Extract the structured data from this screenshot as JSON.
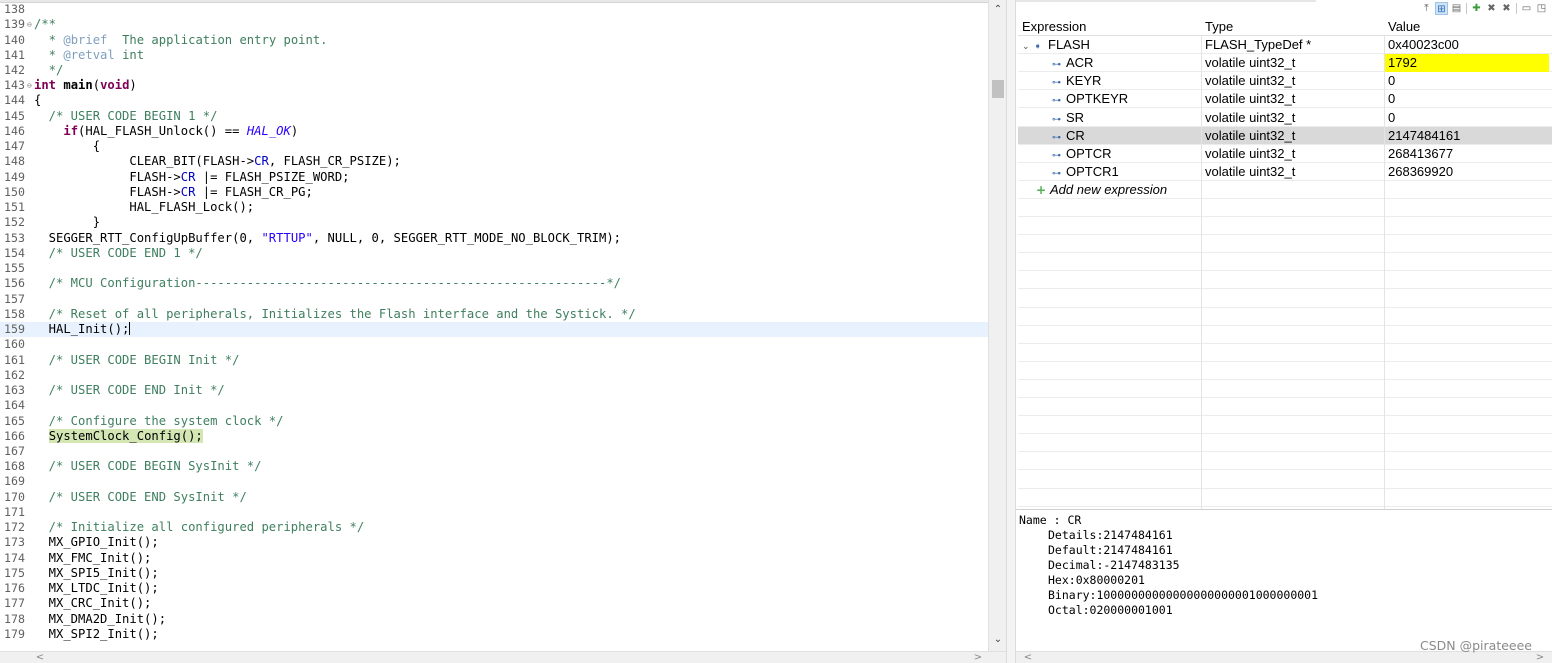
{
  "editor": {
    "lines": [
      {
        "n": "138",
        "fold": "",
        "parts": []
      },
      {
        "n": "139",
        "fold": "⊖",
        "parts": [
          {
            "c": "t-comment",
            "t": "/**"
          }
        ]
      },
      {
        "n": "140",
        "fold": "",
        "parts": [
          {
            "c": "t-comment",
            "t": "  * "
          },
          {
            "c": "t-doctag",
            "t": "@brief"
          },
          {
            "c": "t-comment",
            "t": "  The application entry point."
          }
        ]
      },
      {
        "n": "141",
        "fold": "",
        "parts": [
          {
            "c": "t-comment",
            "t": "  * "
          },
          {
            "c": "t-doctag",
            "t": "@retval"
          },
          {
            "c": "t-comment",
            "t": " int"
          }
        ]
      },
      {
        "n": "142",
        "fold": "",
        "parts": [
          {
            "c": "t-comment",
            "t": "  */"
          }
        ]
      },
      {
        "n": "143",
        "fold": "⊖",
        "parts": [
          {
            "c": "t-keyword",
            "t": "int"
          },
          {
            "c": "",
            "t": " "
          },
          {
            "c": "t-func",
            "t": "main"
          },
          {
            "c": "",
            "t": "("
          },
          {
            "c": "t-keyword",
            "t": "void"
          },
          {
            "c": "",
            "t": ")"
          }
        ]
      },
      {
        "n": "144",
        "fold": "",
        "parts": [
          {
            "c": "",
            "t": "{"
          }
        ]
      },
      {
        "n": "145",
        "fold": "",
        "parts": [
          {
            "c": "t-comment",
            "t": "  /* USER CODE BEGIN 1 */"
          }
        ]
      },
      {
        "n": "146",
        "fold": "",
        "parts": [
          {
            "c": "",
            "t": "    "
          },
          {
            "c": "t-keyword",
            "t": "if"
          },
          {
            "c": "",
            "t": "(HAL_FLASH_Unlock() == "
          },
          {
            "c": "t-macro",
            "t": "HAL_OK"
          },
          {
            "c": "",
            "t": ")"
          }
        ]
      },
      {
        "n": "147",
        "fold": "",
        "parts": [
          {
            "c": "",
            "t": "        {"
          }
        ]
      },
      {
        "n": "148",
        "fold": "",
        "parts": [
          {
            "c": "",
            "t": "             CLEAR_BIT(FLASH->"
          },
          {
            "c": "t-field",
            "t": "CR"
          },
          {
            "c": "",
            "t": ", FLASH_CR_PSIZE);"
          }
        ]
      },
      {
        "n": "149",
        "fold": "",
        "parts": [
          {
            "c": "",
            "t": "             FLASH->"
          },
          {
            "c": "t-field",
            "t": "CR"
          },
          {
            "c": "",
            "t": " |= FLASH_PSIZE_WORD;"
          }
        ]
      },
      {
        "n": "150",
        "fold": "",
        "parts": [
          {
            "c": "",
            "t": "             FLASH->"
          },
          {
            "c": "t-field",
            "t": "CR"
          },
          {
            "c": "",
            "t": " |= FLASH_CR_PG;"
          }
        ]
      },
      {
        "n": "151",
        "fold": "",
        "parts": [
          {
            "c": "",
            "t": "             HAL_FLASH_Lock();"
          }
        ]
      },
      {
        "n": "152",
        "fold": "",
        "parts": [
          {
            "c": "",
            "t": "        }"
          }
        ]
      },
      {
        "n": "153",
        "fold": "",
        "parts": [
          {
            "c": "",
            "t": "  SEGGER_RTT_ConfigUpBuffer(0, "
          },
          {
            "c": "t-string",
            "t": "\"RTTUP\""
          },
          {
            "c": "",
            "t": ", NULL, 0, SEGGER_RTT_MODE_NO_BLOCK_TRIM);"
          }
        ]
      },
      {
        "n": "154",
        "fold": "",
        "parts": [
          {
            "c": "t-comment",
            "t": "  /* USER CODE END 1 */"
          }
        ]
      },
      {
        "n": "155",
        "fold": "",
        "parts": []
      },
      {
        "n": "156",
        "fold": "",
        "parts": [
          {
            "c": "t-comment",
            "t": "  /* MCU Configuration--------------------------------------------------------*/"
          }
        ]
      },
      {
        "n": "157",
        "fold": "",
        "parts": []
      },
      {
        "n": "158",
        "fold": "",
        "parts": [
          {
            "c": "t-comment",
            "t": "  /* Reset of all peripherals, Initializes the Flash interface and the Systick. */"
          }
        ]
      },
      {
        "n": "159",
        "fold": "",
        "current": true,
        "caret": true,
        "parts": [
          {
            "c": "",
            "t": "  HAL_Init();"
          }
        ]
      },
      {
        "n": "160",
        "fold": "",
        "parts": []
      },
      {
        "n": "161",
        "fold": "",
        "parts": [
          {
            "c": "t-comment",
            "t": "  /* USER CODE BEGIN Init */"
          }
        ]
      },
      {
        "n": "162",
        "fold": "",
        "parts": []
      },
      {
        "n": "163",
        "fold": "",
        "parts": [
          {
            "c": "t-comment",
            "t": "  /* USER CODE END Init */"
          }
        ]
      },
      {
        "n": "164",
        "fold": "",
        "parts": []
      },
      {
        "n": "165",
        "fold": "",
        "parts": [
          {
            "c": "t-comment",
            "t": "  /* Configure the system clock */"
          }
        ]
      },
      {
        "n": "166",
        "fold": "",
        "parts": [
          {
            "c": "",
            "t": "  "
          },
          {
            "c": "t-hl",
            "t": "SystemClock_Config();"
          }
        ]
      },
      {
        "n": "167",
        "fold": "",
        "parts": []
      },
      {
        "n": "168",
        "fold": "",
        "parts": [
          {
            "c": "t-comment",
            "t": "  /* USER CODE BEGIN SysInit */"
          }
        ]
      },
      {
        "n": "169",
        "fold": "",
        "parts": []
      },
      {
        "n": "170",
        "fold": "",
        "parts": [
          {
            "c": "t-comment",
            "t": "  /* USER CODE END SysInit */"
          }
        ]
      },
      {
        "n": "171",
        "fold": "",
        "parts": []
      },
      {
        "n": "172",
        "fold": "",
        "parts": [
          {
            "c": "t-comment",
            "t": "  /* Initialize all configured peripherals */"
          }
        ]
      },
      {
        "n": "173",
        "fold": "",
        "parts": [
          {
            "c": "",
            "t": "  MX_GPIO_Init();"
          }
        ]
      },
      {
        "n": "174",
        "fold": "",
        "parts": [
          {
            "c": "",
            "t": "  MX_FMC_Init();"
          }
        ]
      },
      {
        "n": "175",
        "fold": "",
        "parts": [
          {
            "c": "",
            "t": "  MX_SPI5_Init();"
          }
        ]
      },
      {
        "n": "176",
        "fold": "",
        "parts": [
          {
            "c": "",
            "t": "  MX_LTDC_Init();"
          }
        ]
      },
      {
        "n": "177",
        "fold": "",
        "parts": [
          {
            "c": "",
            "t": "  MX_CRC_Init();"
          }
        ]
      },
      {
        "n": "178",
        "fold": "",
        "parts": [
          {
            "c": "",
            "t": "  MX_DMA2D_Init();"
          }
        ]
      },
      {
        "n": "179",
        "fold": "",
        "parts": [
          {
            "c": "",
            "t": "  MX_SPI2_Init();"
          }
        ]
      }
    ],
    "scroll_up_arrow": "⌃",
    "scroll_down_arrow": "⌄",
    "scroll_left_arrow": "<",
    "scroll_right_arrow": ">"
  },
  "expressions": {
    "toolbar_icons": [
      "collapse-all-icon",
      "show-type-names-icon",
      "layout-icon",
      "add-expression-icon",
      "remove-icon",
      "remove-all-icon",
      "minimize-icon",
      "maximize-icon"
    ],
    "columns": {
      "expression": "Expression",
      "type": "Type",
      "value": "Value"
    },
    "rows": [
      {
        "expression": "FLASH",
        "type": "FLASH_TypeDef *",
        "value": "0x40023c00",
        "level": 0,
        "expanded": true,
        "changed": false,
        "selected": false
      },
      {
        "expression": "ACR",
        "type": "volatile uint32_t",
        "value": "1792",
        "level": 1,
        "changed": true,
        "selected": false
      },
      {
        "expression": "KEYR",
        "type": "volatile uint32_t",
        "value": "0",
        "level": 1,
        "changed": false,
        "selected": false
      },
      {
        "expression": "OPTKEYR",
        "type": "volatile uint32_t",
        "value": "0",
        "level": 1,
        "changed": false,
        "selected": false
      },
      {
        "expression": "SR",
        "type": "volatile uint32_t",
        "value": "0",
        "level": 1,
        "changed": false,
        "selected": false
      },
      {
        "expression": "CR",
        "type": "volatile uint32_t",
        "value": "2147484161",
        "level": 1,
        "changed": false,
        "selected": true
      },
      {
        "expression": "OPTCR",
        "type": "volatile uint32_t",
        "value": "268413677",
        "level": 1,
        "changed": false,
        "selected": false
      },
      {
        "expression": "OPTCR1",
        "type": "volatile uint32_t",
        "value": "268369920",
        "level": 1,
        "changed": false,
        "selected": false
      }
    ],
    "add_new_label": "Add new expression",
    "field_icon_glyph": "⊶",
    "details": {
      "name_line": "Name : CR",
      "lines": [
        "Details:2147484161",
        "Default:2147484161",
        "Decimal:-2147483135",
        "Hex:0x80000201",
        "Binary:10000000000000000000001000000001",
        "Octal:020000001001"
      ]
    }
  },
  "watermark": "CSDN @pirateeee",
  "colors": {
    "changed_value": "#ffff00",
    "selected_row": "#d9d9d9",
    "current_line": "#e8f2fe",
    "comment": "#3f7f5f",
    "keyword": "#7f0055"
  }
}
